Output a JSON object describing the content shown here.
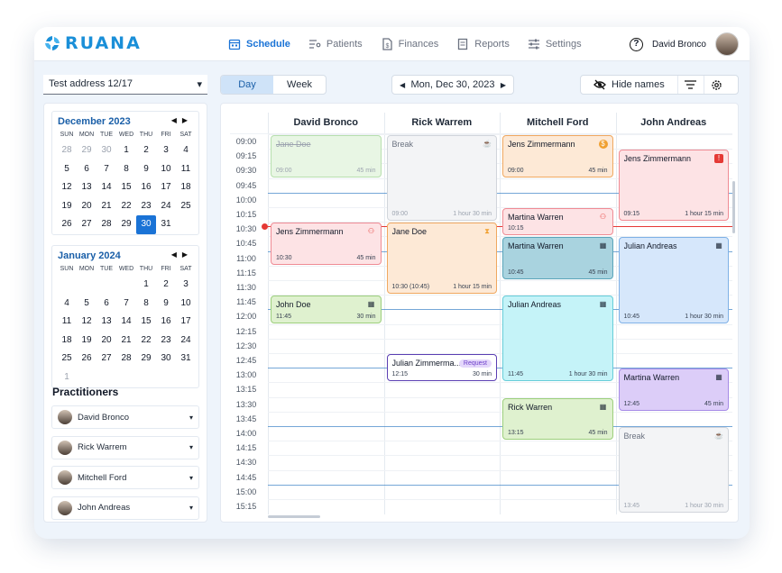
{
  "brand": {
    "name": "RUANA",
    "color": "#1a8fd8"
  },
  "nav": [
    {
      "label": "Schedule",
      "icon": "calendar-icon",
      "active": true
    },
    {
      "label": "Patients",
      "icon": "list-user-icon",
      "active": false
    },
    {
      "label": "Finances",
      "icon": "dollar-doc-icon",
      "active": false
    },
    {
      "label": "Reports",
      "icon": "report-icon",
      "active": false
    },
    {
      "label": "Settings",
      "icon": "sliders-icon",
      "active": false
    }
  ],
  "user": {
    "name": "David Bronco",
    "help_icon": "?"
  },
  "address": {
    "value": "Test address 12/17"
  },
  "view": {
    "day": "Day",
    "week": "Week",
    "active": "Day"
  },
  "date_nav": {
    "label": "Mon, Dec 30, 2023",
    "prev": "◀",
    "next": "▶"
  },
  "tools": {
    "hide_names": "Hide names"
  },
  "calendars": [
    {
      "title": "December 2023",
      "dow": [
        "SUN",
        "MON",
        "TUE",
        "WED",
        "THU",
        "FRI",
        "SAT"
      ],
      "days": [
        {
          "d": "28",
          "m": true
        },
        {
          "d": "29",
          "m": true
        },
        {
          "d": "30",
          "m": true
        },
        {
          "d": "1"
        },
        {
          "d": "2"
        },
        {
          "d": "3"
        },
        {
          "d": "4"
        },
        {
          "d": "5"
        },
        {
          "d": "6"
        },
        {
          "d": "7"
        },
        {
          "d": "8"
        },
        {
          "d": "9"
        },
        {
          "d": "10"
        },
        {
          "d": "11"
        },
        {
          "d": "12"
        },
        {
          "d": "13"
        },
        {
          "d": "14"
        },
        {
          "d": "15"
        },
        {
          "d": "16"
        },
        {
          "d": "17"
        },
        {
          "d": "18"
        },
        {
          "d": "19"
        },
        {
          "d": "20"
        },
        {
          "d": "21"
        },
        {
          "d": "22"
        },
        {
          "d": "23"
        },
        {
          "d": "24"
        },
        {
          "d": "25"
        },
        {
          "d": "26"
        },
        {
          "d": "27"
        },
        {
          "d": "28"
        },
        {
          "d": "29"
        },
        {
          "d": "30",
          "sel": true
        },
        {
          "d": "31"
        },
        {
          "d": ""
        }
      ]
    },
    {
      "title": "January 2024",
      "dow": [
        "SUN",
        "MON",
        "TUE",
        "WED",
        "THU",
        "FRI",
        "SAT"
      ],
      "days": [
        {
          "d": ""
        },
        {
          "d": ""
        },
        {
          "d": ""
        },
        {
          "d": ""
        },
        {
          "d": "1"
        },
        {
          "d": "2"
        },
        {
          "d": "3"
        },
        {
          "d": "4"
        },
        {
          "d": "5"
        },
        {
          "d": "6"
        },
        {
          "d": "7"
        },
        {
          "d": "8"
        },
        {
          "d": "9"
        },
        {
          "d": "10"
        },
        {
          "d": "11"
        },
        {
          "d": "12"
        },
        {
          "d": "13"
        },
        {
          "d": "14"
        },
        {
          "d": "15"
        },
        {
          "d": "16"
        },
        {
          "d": "17"
        },
        {
          "d": "18"
        },
        {
          "d": "19"
        },
        {
          "d": "20"
        },
        {
          "d": "21"
        },
        {
          "d": "22"
        },
        {
          "d": "23"
        },
        {
          "d": "24"
        },
        {
          "d": "25"
        },
        {
          "d": "26"
        },
        {
          "d": "27"
        },
        {
          "d": "28"
        },
        {
          "d": "29"
        },
        {
          "d": "30"
        },
        {
          "d": "31"
        },
        {
          "d": "1",
          "m": true
        }
      ]
    }
  ],
  "practitioners_title": "Practitioners",
  "practitioners": [
    "David Bronco",
    "Rick Warrem",
    "Mitchell Ford",
    "John Andreas"
  ],
  "columns": [
    "David Bronco",
    "Rick Warrem",
    "Mitchell Ford",
    "John Andreas"
  ],
  "times": [
    "09:00",
    "09:15",
    "09:30",
    "09:45",
    "10:00",
    "10:15",
    "10:30",
    "10:45",
    "11:00",
    "11:15",
    "11:30",
    "11:45",
    "12:00",
    "12:15",
    "12:30",
    "12:45",
    "13:00",
    "13:15",
    "13:30",
    "13:45",
    "14:00",
    "14:15",
    "14:30",
    "14:45",
    "15:00",
    "15:15"
  ],
  "events": [
    {
      "col": 0,
      "title": "Jane Doe",
      "start": "09:00",
      "dur": "45 min",
      "slot": 0,
      "len": 3,
      "kind": "cancelled",
      "strike": true
    },
    {
      "col": 1,
      "title": "Break",
      "start": "09:00",
      "dur": "1 hour 30 min",
      "slot": 0,
      "len": 6,
      "kind": "break",
      "icon": "break-icon"
    },
    {
      "col": 2,
      "title": "Jens Zimmermann",
      "start": "09:00",
      "dur": "45 min",
      "slot": 0,
      "len": 3,
      "kind": "orange",
      "icon": "dollar-icon"
    },
    {
      "col": 3,
      "title": "Jens Zimmermann",
      "start": "09:15",
      "dur": "1 hour 15 min",
      "slot": 1,
      "len": 5,
      "kind": "red",
      "icon": "alert-doc-icon"
    },
    {
      "col": 0,
      "title": "Jens Zimmermann",
      "start": "10:30",
      "dur": "45 min",
      "slot": 6,
      "len": 3,
      "kind": "red",
      "icon": "user-x-icon"
    },
    {
      "col": 1,
      "title": "Jane Doe",
      "start": "10:30 (10:45)",
      "dur": "1 hour 15 min",
      "slot": 6,
      "len": 5,
      "kind": "orange",
      "icon": "hourglass-icon"
    },
    {
      "col": 2,
      "title": "Martina Warren",
      "start": "10:15",
      "dur": "",
      "slot": 5,
      "len": 2,
      "kind": "red",
      "icon": "user-x-icon"
    },
    {
      "col": 2,
      "title": "Martina Warren",
      "start": "10:45",
      "dur": "45 min",
      "slot": 7,
      "len": 3,
      "kind": "teal",
      "icon": "calendar-icon"
    },
    {
      "col": 3,
      "title": "Julian Andreas",
      "start": "10:45",
      "dur": "1 hour 30 min",
      "slot": 7,
      "len": 6,
      "kind": "blue",
      "icon": "calendar-icon"
    },
    {
      "col": 0,
      "title": "John Doe",
      "start": "11:45",
      "dur": "30 min",
      "slot": 11,
      "len": 2,
      "kind": "green",
      "icon": "calendar-icon"
    },
    {
      "col": 2,
      "title": "Julian Andreas",
      "start": "11:45",
      "dur": "1 hour 30 min",
      "slot": 11,
      "len": 6,
      "kind": "cyan",
      "icon": "calendar-icon"
    },
    {
      "col": 1,
      "title": "Julian Zimmerma...",
      "start": "12:15",
      "dur": "30 min",
      "slot": 15,
      "len": 2,
      "kind": "request",
      "badge": "Request"
    },
    {
      "col": 3,
      "title": "Martina Warren",
      "start": "12:45",
      "dur": "45 min",
      "slot": 16,
      "len": 3,
      "kind": "purple",
      "icon": "calendar-icon"
    },
    {
      "col": 2,
      "title": "Rick Warren",
      "start": "13:15",
      "dur": "45 min",
      "slot": 18,
      "len": 3,
      "kind": "green",
      "icon": "calendar-icon"
    },
    {
      "col": 3,
      "title": "Break",
      "start": "13:45",
      "dur": "1 hour 30 min",
      "slot": 20,
      "len": 6,
      "kind": "break",
      "icon": "break-icon"
    }
  ],
  "colors": {
    "accent": "#1a73d6",
    "cancelled": [
      "#e8f6e4",
      "#b7dfae"
    ],
    "break": [
      "#f3f4f6",
      "#d1d5db"
    ],
    "orange": [
      "#fde9d6",
      "#f0a860"
    ],
    "red": [
      "#fde3e5",
      "#ef8b94"
    ],
    "teal": [
      "#a9d3df",
      "#5aa5ba"
    ],
    "blue": [
      "#d6e7fb",
      "#7fb1e6"
    ],
    "green": [
      "#dff1cf",
      "#9ccf7c"
    ],
    "cyan": [
      "#c5f3f8",
      "#66cdd8"
    ],
    "purple": [
      "#dccdf8",
      "#a58ae6"
    ],
    "request": [
      "#ffffff",
      "#5b3fb3"
    ],
    "now": "#e53935"
  }
}
